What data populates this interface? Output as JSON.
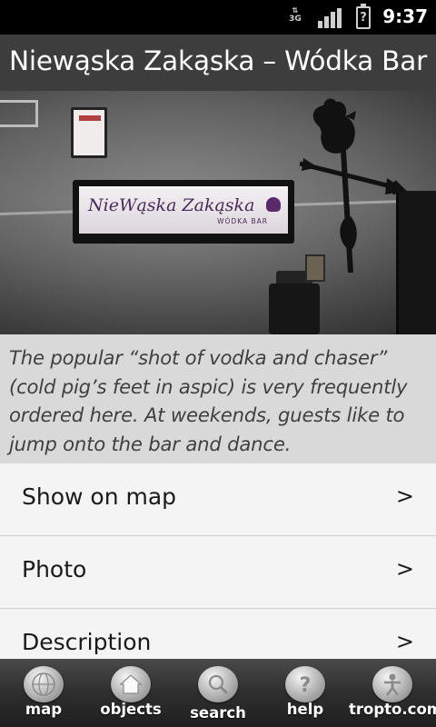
{
  "status_bar": {
    "network_type": "3G",
    "battery_symbol": "?",
    "time": "9:37"
  },
  "header": {
    "title": "Niewąska Zakąska – Wódka Bar"
  },
  "photo": {
    "sign_text": "NieWąska Zakąska",
    "sign_subtext": "WÓDKA BAR"
  },
  "description": {
    "text": "The popular “shot of vodka and chaser” (cold pig’s feet in aspic) is very frequently ordered here. At weekends, guests like to jump onto the bar and dance."
  },
  "menu": {
    "items": [
      {
        "label": "Show on map",
        "chevron": ">"
      },
      {
        "label": "Photo",
        "chevron": ">"
      },
      {
        "label": "Description",
        "chevron": ">"
      }
    ]
  },
  "toolbar": {
    "items": [
      {
        "label": "map",
        "icon": "globe-icon"
      },
      {
        "label": "objects",
        "icon": "house-icon"
      },
      {
        "label": "search",
        "icon": "magnifier-icon"
      },
      {
        "label": "help",
        "icon": "question-icon"
      },
      {
        "label": "tropto.com",
        "icon": "person-icon"
      }
    ]
  },
  "colors": {
    "title_bar": "#3d3d3d",
    "description_bg": "#d9d9d9",
    "menu_bg": "#f4f4f4",
    "toolbar_bg": "#2e2e2e"
  }
}
